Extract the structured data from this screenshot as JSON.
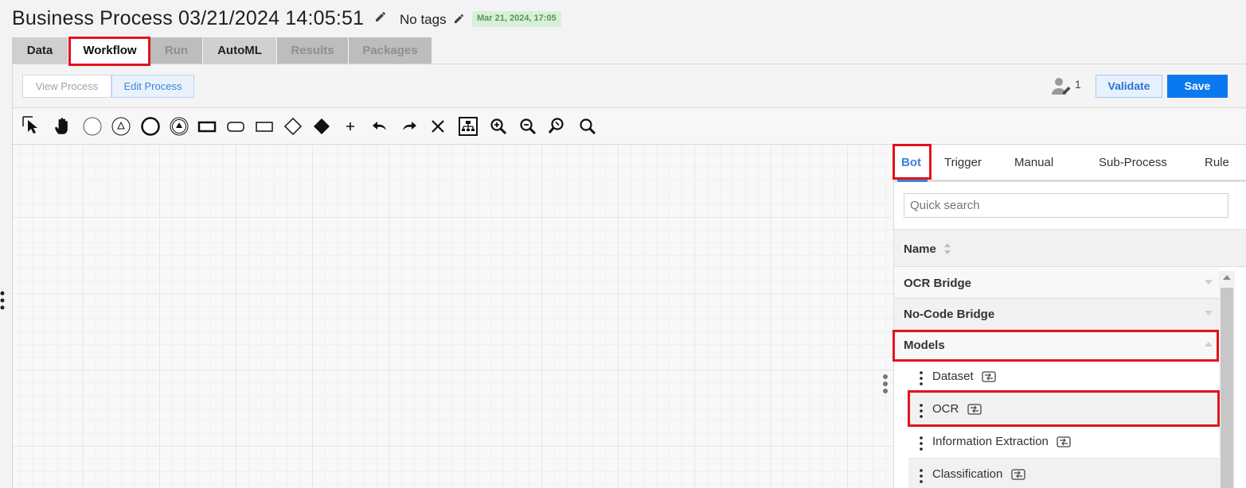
{
  "header": {
    "title": "Business Process 03/21/2024 14:05:51",
    "tags_label": "No tags",
    "date_badge": "Mar 21, 2024, 17:05"
  },
  "main_tabs": [
    {
      "label": "Data",
      "state": "normal"
    },
    {
      "label": "Workflow",
      "state": "active"
    },
    {
      "label": "Run",
      "state": "disabled"
    },
    {
      "label": "AutoML",
      "state": "normal"
    },
    {
      "label": "Results",
      "state": "disabled"
    },
    {
      "label": "Packages",
      "state": "disabled"
    }
  ],
  "mode": {
    "view_label": "View Process",
    "edit_label": "Edit Process",
    "active": "Edit Process"
  },
  "actions": {
    "editor_count": "1",
    "validate_label": "Validate",
    "save_label": "Save"
  },
  "tools": [
    "pointer-icon",
    "hand-icon",
    "start-event-icon",
    "message-start-event-icon",
    "end-event-icon",
    "signal-end-event-icon",
    "task-icon",
    "rounded-task-icon",
    "subprocess-icon",
    "exclusive-gateway-icon",
    "parallel-gateway-icon",
    "add-icon",
    "undo-icon",
    "redo-icon",
    "delete-icon",
    "auto-layout-icon",
    "zoom-in-icon",
    "zoom-out-icon",
    "zoom-reset-icon",
    "zoom-fit-icon"
  ],
  "palette": {
    "tabs": [
      "Bot",
      "Trigger",
      "Manual",
      "Sub-Process",
      "Rule"
    ],
    "active_tab": "Bot",
    "search_placeholder": "Quick search",
    "column_header": "Name",
    "groups": [
      {
        "label": "OCR Bridge",
        "expanded": false
      },
      {
        "label": "No-Code Bridge",
        "expanded": false
      },
      {
        "label": "Models",
        "expanded": true
      }
    ],
    "items": [
      {
        "label": "Dataset"
      },
      {
        "label": "OCR"
      },
      {
        "label": "Information Extraction"
      },
      {
        "label": "Classification"
      }
    ]
  },
  "colors": {
    "accent": "#0a79f0",
    "highlight": "#e0141e",
    "badge_bg": "#d9f0d8",
    "badge_text": "#56955a"
  }
}
